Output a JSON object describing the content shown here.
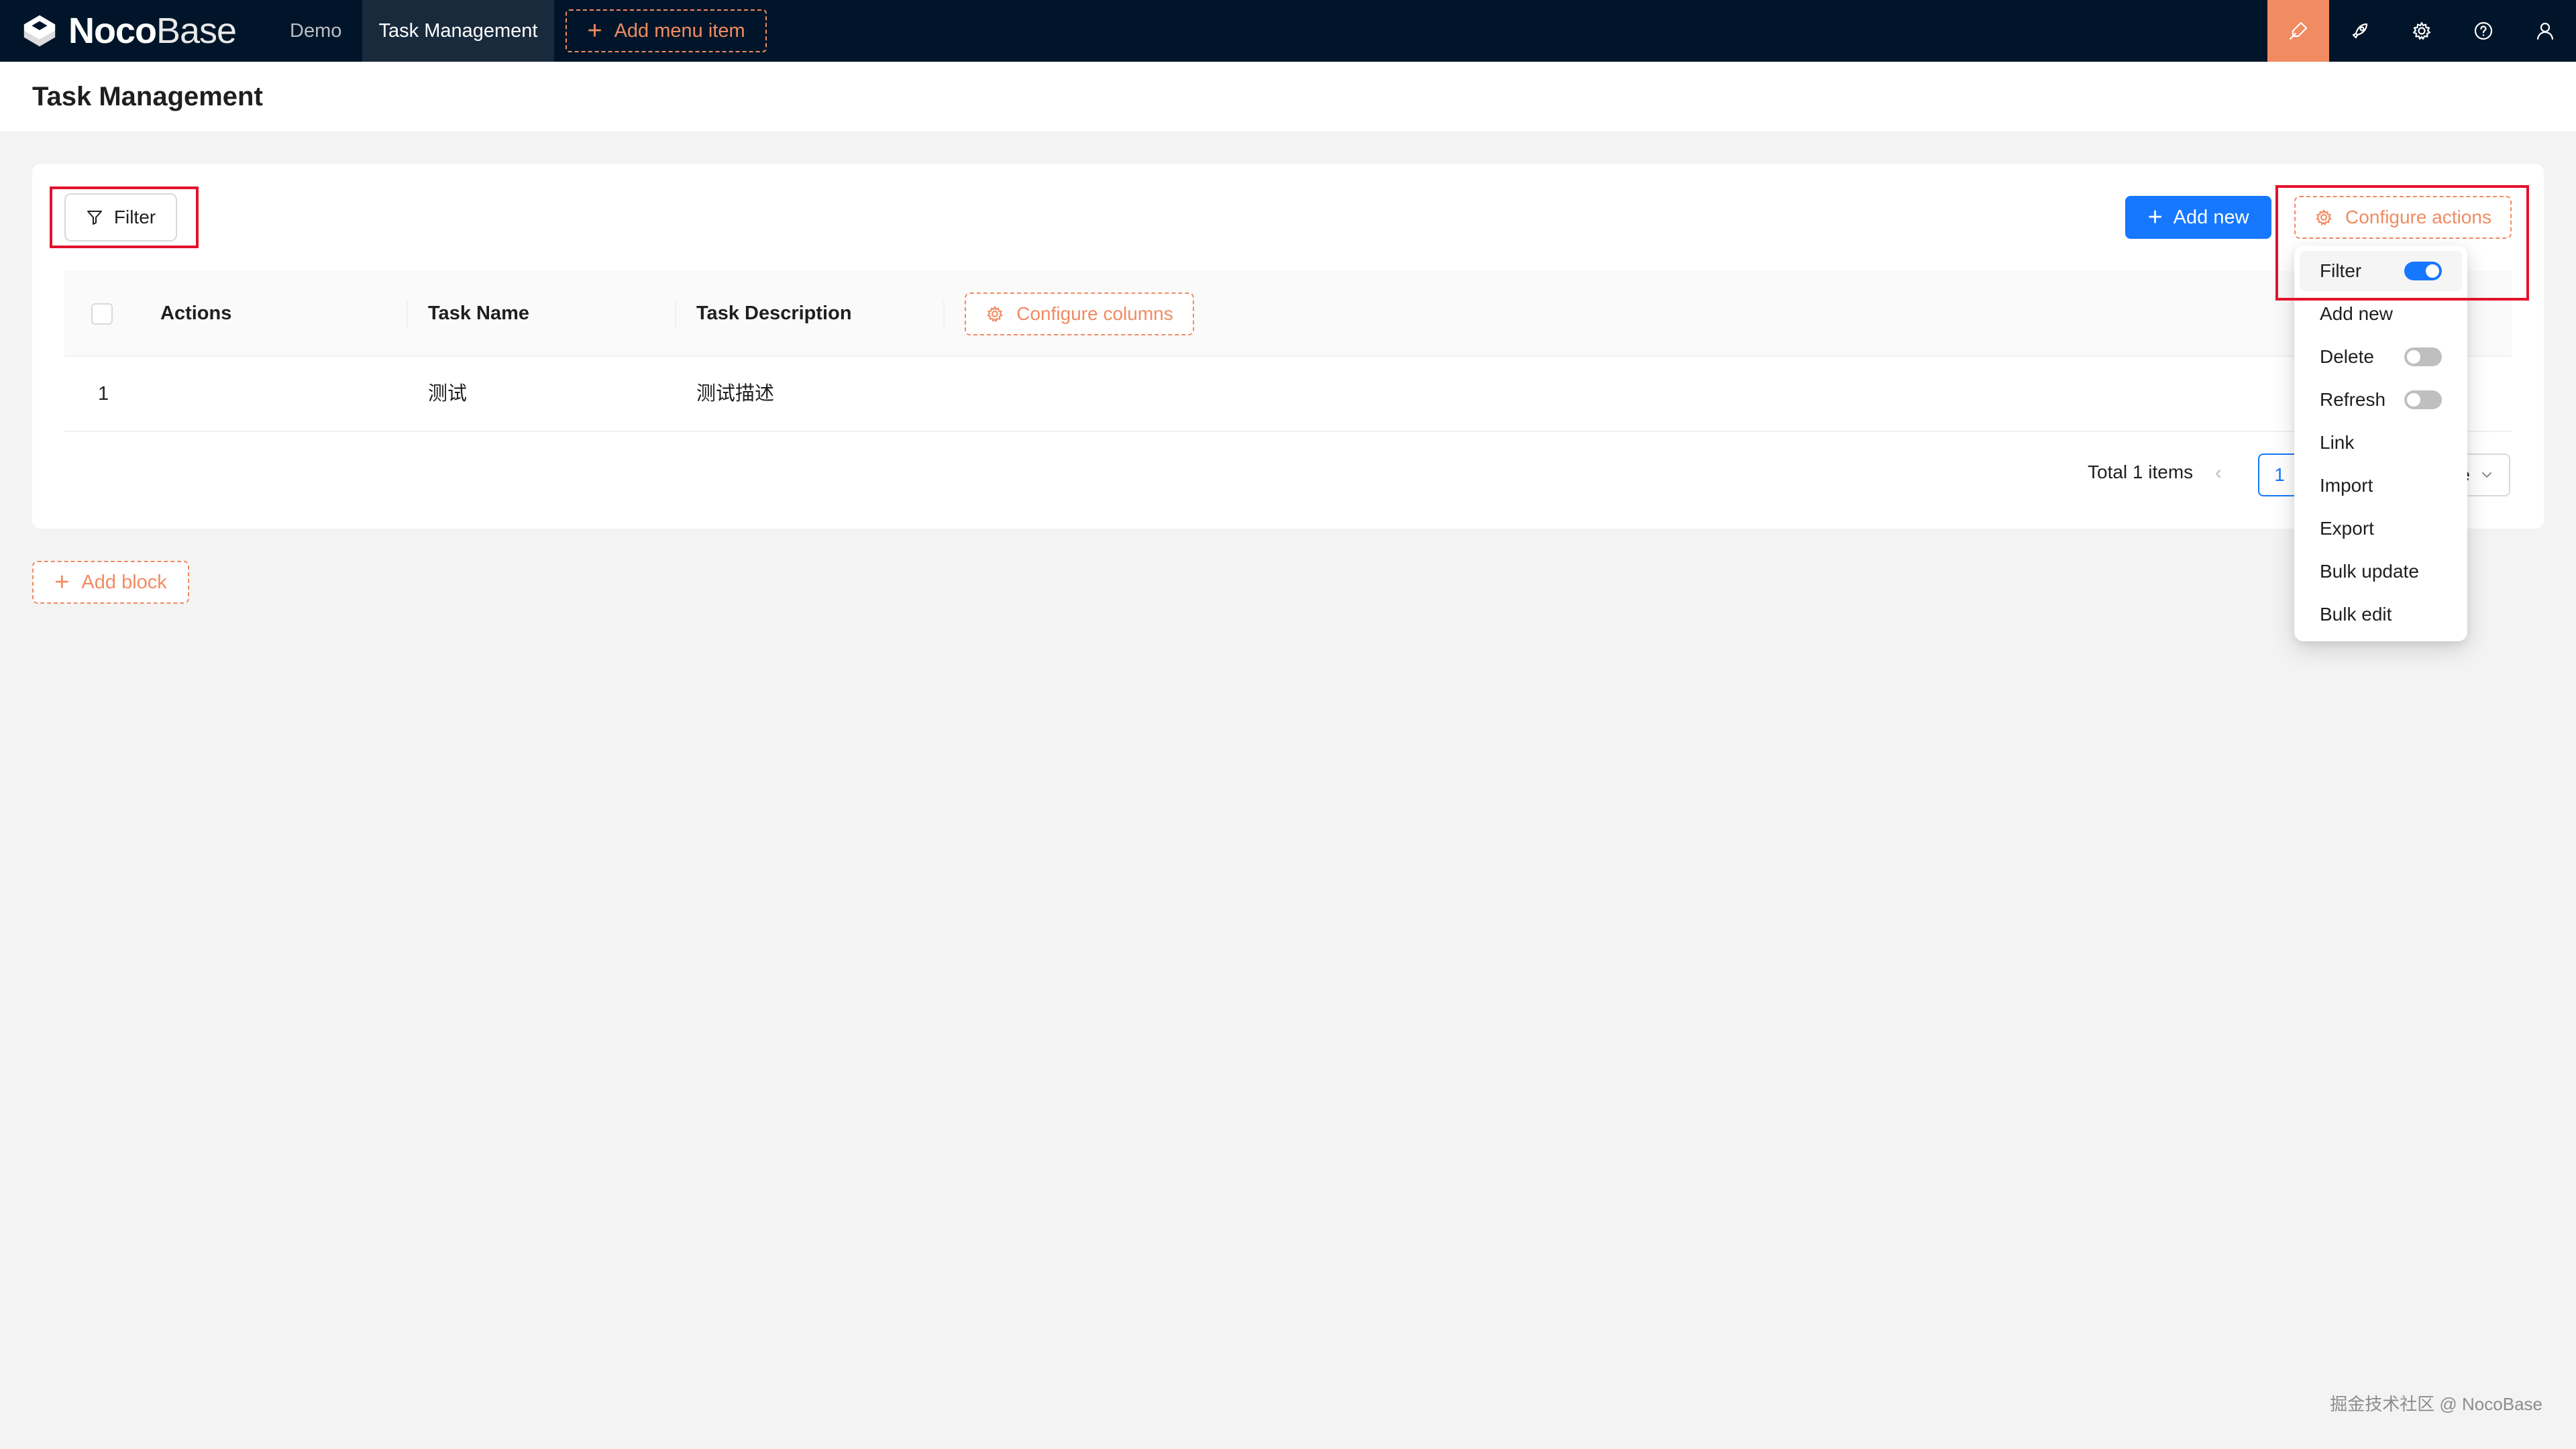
{
  "app": {
    "logo_bold": "Noco",
    "logo_light": "Base",
    "nav": {
      "demo": "Demo",
      "task_management": "Task Management",
      "add_menu_item": "Add menu item"
    },
    "icons": [
      "ui-editor-icon",
      "plugin-rocket-icon",
      "settings-gear-icon",
      "help-icon",
      "user-icon"
    ]
  },
  "page": {
    "title": "Task Management"
  },
  "block": {
    "filter_label": "Filter",
    "add_new_label": "Add new",
    "configure_actions_label": "Configure actions",
    "configure_columns_label": "Configure columns",
    "columns": [
      "Actions",
      "Task Name",
      "Task Description"
    ],
    "rows": [
      {
        "index": "1",
        "task_name": "测试",
        "task_description": "测试描述"
      }
    ],
    "pagination": {
      "total_text": "Total 1 items",
      "current_page": "1",
      "page_size_visible": "e"
    }
  },
  "add_block_label": "Add block",
  "configure_actions_menu": [
    {
      "label": "Filter",
      "toggle": true,
      "enabled": true
    },
    {
      "label": "Add new",
      "toggle": false
    },
    {
      "label": "Delete",
      "toggle": true,
      "enabled": false
    },
    {
      "label": "Refresh",
      "toggle": true,
      "enabled": false
    },
    {
      "label": "Link",
      "toggle": false
    },
    {
      "label": "Import",
      "toggle": false
    },
    {
      "label": "Export",
      "toggle": false
    },
    {
      "label": "Bulk update",
      "toggle": false
    },
    {
      "label": "Bulk edit",
      "toggle": false
    }
  ],
  "watermark": "掘金技术社区 @ NocoBase",
  "colors": {
    "nav_bg": "#001529",
    "accent_orange": "#f18b62",
    "primary_blue": "#1677ff",
    "highlight_red": "#e3112b"
  }
}
